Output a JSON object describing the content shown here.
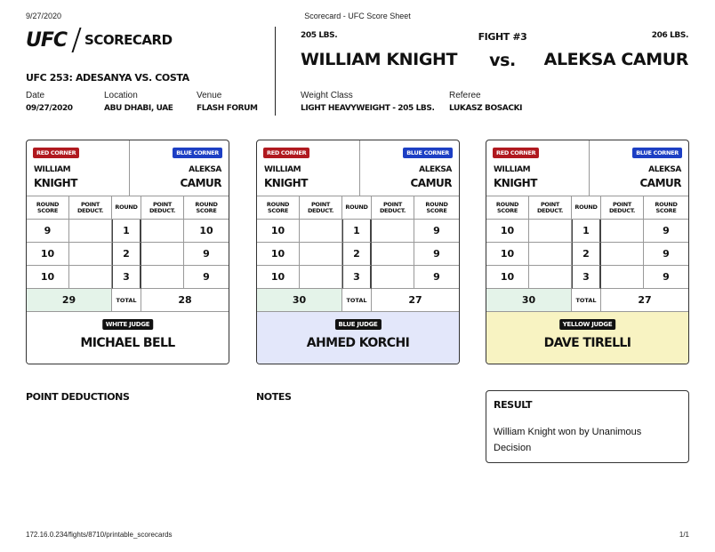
{
  "print": {
    "date": "9/27/2020",
    "title": "Scorecard - UFC Score Sheet",
    "url": "172.16.0.234/fights/8710/printable_scorecards",
    "page": "1/1"
  },
  "header": {
    "logo_brand": "UFC",
    "logo_text": "SCORECARD",
    "event": "UFC 253: ADESANYA VS. COSTA",
    "date_label": "Date",
    "date_value": "09/27/2020",
    "location_label": "Location",
    "location_value": "ABU DHABI, UAE",
    "venue_label": "Venue",
    "venue_value": "FLASH FORUM",
    "weight_class_label": "Weight Class",
    "weight_class_value": "LIGHT HEAVYWEIGHT - 205 LBS.",
    "referee_label": "Referee",
    "referee_value": "LUKASZ BOSACKI"
  },
  "fight": {
    "number": "FIGHT #3",
    "vs": "vs.",
    "red_weight": "205 LBS.",
    "red_name": "WILLIAM KNIGHT",
    "blue_weight": "206 LBS.",
    "blue_name": "ALEKSA CAMUR"
  },
  "labels": {
    "red_corner": "RED CORNER",
    "blue_corner": "BLUE CORNER",
    "red_first": "WILLIAM",
    "red_last": "KNIGHT",
    "blue_first": "ALEKSA",
    "blue_last": "CAMUR",
    "round_score": "ROUND SCORE",
    "point_deduct": "POINT DEDUCT.",
    "round": "ROUND",
    "total": "TOTAL"
  },
  "cards": [
    {
      "judge_label": "WHITE JUDGE",
      "judge_name": "MICHAEL BELL",
      "judge_color": "#ffffff",
      "rounds": [
        {
          "red": "9",
          "red_ded": "",
          "round": "1",
          "blue_ded": "",
          "blue": "10"
        },
        {
          "red": "10",
          "red_ded": "",
          "round": "2",
          "blue_ded": "",
          "blue": "9"
        },
        {
          "red": "10",
          "red_ded": "",
          "round": "3",
          "blue_ded": "",
          "blue": "9"
        }
      ],
      "red_total": "29",
      "blue_total": "28"
    },
    {
      "judge_label": "BLUE JUDGE",
      "judge_name": "AHMED KORCHI",
      "judge_color": "#e3e7fa",
      "rounds": [
        {
          "red": "10",
          "red_ded": "",
          "round": "1",
          "blue_ded": "",
          "blue": "9"
        },
        {
          "red": "10",
          "red_ded": "",
          "round": "2",
          "blue_ded": "",
          "blue": "9"
        },
        {
          "red": "10",
          "red_ded": "",
          "round": "3",
          "blue_ded": "",
          "blue": "9"
        }
      ],
      "red_total": "30",
      "blue_total": "27"
    },
    {
      "judge_label": "YELLOW JUDGE",
      "judge_name": "DAVE TIRELLI",
      "judge_color": "#f8f3c2",
      "rounds": [
        {
          "red": "10",
          "red_ded": "",
          "round": "1",
          "blue_ded": "",
          "blue": "9"
        },
        {
          "red": "10",
          "red_ded": "",
          "round": "2",
          "blue_ded": "",
          "blue": "9"
        },
        {
          "red": "10",
          "red_ded": "",
          "round": "3",
          "blue_ded": "",
          "blue": "9"
        }
      ],
      "red_total": "30",
      "blue_total": "27"
    }
  ],
  "sections": {
    "point_deductions": "POINT DEDUCTIONS",
    "notes": "NOTES",
    "result_title": "RESULT",
    "result_text": "William Knight won by Unanimous Decision"
  },
  "colors": {
    "red_corner": "#b0191f",
    "blue_corner": "#1d3fc4",
    "total_highlight": "#e4f3e9"
  }
}
